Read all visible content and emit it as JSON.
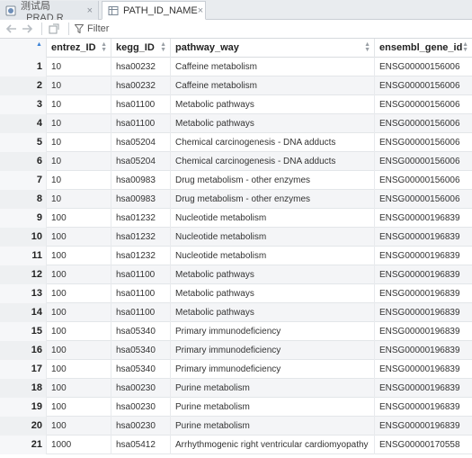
{
  "tabs": [
    {
      "label": "测试局_PRAD.R",
      "close": "×"
    },
    {
      "label": "PATH_ID_NAME",
      "close": "×"
    }
  ],
  "toolbar": {
    "filter_label": "Filter"
  },
  "table": {
    "columns": [
      "",
      "entrez_ID",
      "kegg_ID",
      "pathway_way",
      "ensembl_gene_id"
    ],
    "rows": [
      [
        "1",
        "10",
        "hsa00232",
        "Caffeine metabolism",
        "ENSG00000156006"
      ],
      [
        "2",
        "10",
        "hsa00232",
        "Caffeine metabolism",
        "ENSG00000156006"
      ],
      [
        "3",
        "10",
        "hsa01100",
        "Metabolic pathways",
        "ENSG00000156006"
      ],
      [
        "4",
        "10",
        "hsa01100",
        "Metabolic pathways",
        "ENSG00000156006"
      ],
      [
        "5",
        "10",
        "hsa05204",
        "Chemical carcinogenesis - DNA adducts",
        "ENSG00000156006"
      ],
      [
        "6",
        "10",
        "hsa05204",
        "Chemical carcinogenesis - DNA adducts",
        "ENSG00000156006"
      ],
      [
        "7",
        "10",
        "hsa00983",
        "Drug metabolism - other enzymes",
        "ENSG00000156006"
      ],
      [
        "8",
        "10",
        "hsa00983",
        "Drug metabolism - other enzymes",
        "ENSG00000156006"
      ],
      [
        "9",
        "100",
        "hsa01232",
        "Nucleotide metabolism",
        "ENSG00000196839"
      ],
      [
        "10",
        "100",
        "hsa01232",
        "Nucleotide metabolism",
        "ENSG00000196839"
      ],
      [
        "11",
        "100",
        "hsa01232",
        "Nucleotide metabolism",
        "ENSG00000196839"
      ],
      [
        "12",
        "100",
        "hsa01100",
        "Metabolic pathways",
        "ENSG00000196839"
      ],
      [
        "13",
        "100",
        "hsa01100",
        "Metabolic pathways",
        "ENSG00000196839"
      ],
      [
        "14",
        "100",
        "hsa01100",
        "Metabolic pathways",
        "ENSG00000196839"
      ],
      [
        "15",
        "100",
        "hsa05340",
        "Primary immunodeficiency",
        "ENSG00000196839"
      ],
      [
        "16",
        "100",
        "hsa05340",
        "Primary immunodeficiency",
        "ENSG00000196839"
      ],
      [
        "17",
        "100",
        "hsa05340",
        "Primary immunodeficiency",
        "ENSG00000196839"
      ],
      [
        "18",
        "100",
        "hsa00230",
        "Purine metabolism",
        "ENSG00000196839"
      ],
      [
        "19",
        "100",
        "hsa00230",
        "Purine metabolism",
        "ENSG00000196839"
      ],
      [
        "20",
        "100",
        "hsa00230",
        "Purine metabolism",
        "ENSG00000196839"
      ],
      [
        "21",
        "1000",
        "hsa05412",
        "Arrhythmogenic right ventricular cardiomyopathy",
        "ENSG00000170558"
      ]
    ]
  }
}
